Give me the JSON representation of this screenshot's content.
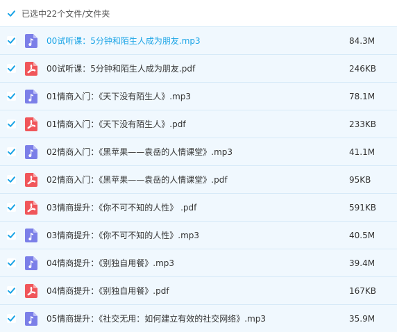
{
  "header": {
    "summary": "已选中22个文件/文件夹"
  },
  "files": [
    {
      "name": "00试听课：5分钟和陌生人成为朋友.mp3",
      "size": "84.3M",
      "type": "audio",
      "active": true
    },
    {
      "name": "00试听课：5分钟和陌生人成为朋友.pdf",
      "size": "246KB",
      "type": "pdf",
      "active": false
    },
    {
      "name": "01情商入门：《天下没有陌生人》.mp3",
      "size": "78.1M",
      "type": "audio",
      "active": false
    },
    {
      "name": "01情商入门：《天下没有陌生人》.pdf",
      "size": "233KB",
      "type": "pdf",
      "active": false
    },
    {
      "name": "02情商入门：《黑苹果——袁岳的人情课堂》.mp3",
      "size": "41.1M",
      "type": "audio",
      "active": false
    },
    {
      "name": "02情商入门：《黑苹果——袁岳的人情课堂》.pdf",
      "size": "95KB",
      "type": "pdf",
      "active": false
    },
    {
      "name": "03情商提升：《你不可不知的人性》 .pdf",
      "size": "591KB",
      "type": "pdf",
      "active": false
    },
    {
      "name": "03情商提升：《你不可不知的人性》.mp3",
      "size": "40.5M",
      "type": "audio",
      "active": false
    },
    {
      "name": "04情商提升：《别独自用餐》.mp3",
      "size": "39.4M",
      "type": "audio",
      "active": false
    },
    {
      "name": "04情商提升：《别独自用餐》.pdf",
      "size": "167KB",
      "type": "pdf",
      "active": false
    },
    {
      "name": "05情商提升：《社交无用：如何建立有效的社交网络》.mp3",
      "size": "35.9M",
      "type": "audio",
      "active": false
    }
  ],
  "colors": {
    "accent": "#1aa4e6",
    "row_background": "#f0f8fe",
    "audio_icon": "#7b7fe8",
    "pdf_icon": "#f0565a"
  }
}
